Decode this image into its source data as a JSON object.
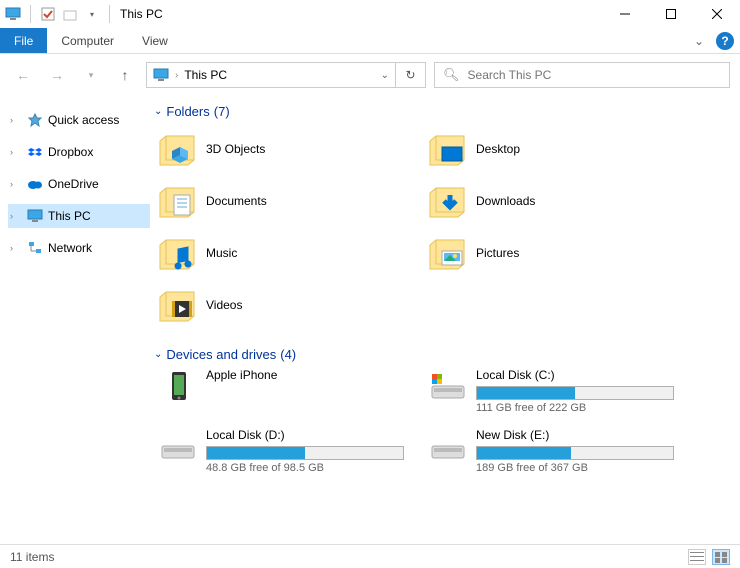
{
  "window": {
    "title": "This PC"
  },
  "ribbon": {
    "file": "File",
    "computer": "Computer",
    "view": "View"
  },
  "address": {
    "text": "This PC"
  },
  "search": {
    "placeholder": "Search This PC"
  },
  "sidebar": {
    "items": [
      {
        "label": "Quick access",
        "icon": "star"
      },
      {
        "label": "Dropbox",
        "icon": "dropbox"
      },
      {
        "label": "OneDrive",
        "icon": "cloud"
      },
      {
        "label": "This PC",
        "icon": "pc",
        "selected": true
      },
      {
        "label": "Network",
        "icon": "network"
      }
    ]
  },
  "sections": {
    "folders": {
      "title": "Folders",
      "count": 7
    },
    "drives": {
      "title": "Devices and drives",
      "count": 4
    }
  },
  "folders": [
    {
      "name": "3D Objects"
    },
    {
      "name": "Desktop"
    },
    {
      "name": "Documents"
    },
    {
      "name": "Downloads"
    },
    {
      "name": "Music"
    },
    {
      "name": "Pictures"
    },
    {
      "name": "Videos"
    }
  ],
  "drives": [
    {
      "name": "Apple iPhone",
      "type": "device"
    },
    {
      "name": "Local Disk (C:)",
      "free": "111 GB free of 222 GB",
      "usedPct": 50
    },
    {
      "name": "Local Disk (D:)",
      "free": "48.8 GB free of 98.5 GB",
      "usedPct": 50
    },
    {
      "name": "New Disk (E:)",
      "free": "189 GB free of 367 GB",
      "usedPct": 48
    }
  ],
  "status": {
    "count": "11 items"
  }
}
